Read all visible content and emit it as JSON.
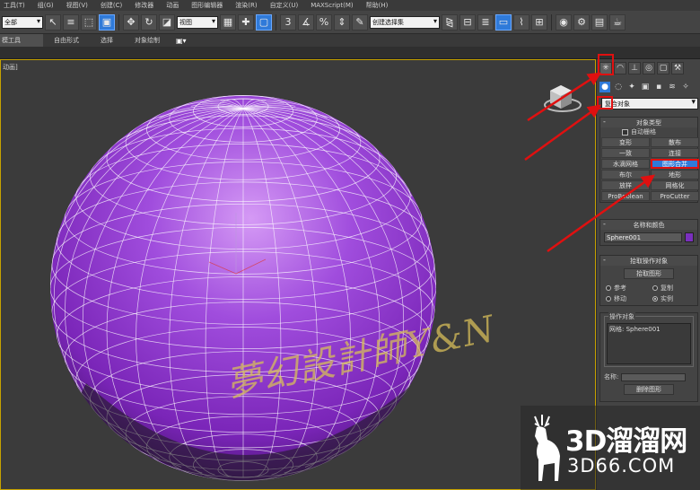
{
  "menubar": {
    "items": [
      "工具(T)",
      "组(G)",
      "视图(V)",
      "创建(C)",
      "修改器",
      "动画",
      "图形编辑器",
      "渲染(R)",
      "自定义(U)",
      "MAXScript(M)",
      "帮助(H)"
    ]
  },
  "toolbar": {
    "selection_filter": "全部",
    "reference_coord": "视图",
    "named_selection": "创建选择集",
    "icons": [
      "undo-icon",
      "redo-icon",
      "link-icon",
      "unlink-icon",
      "bind-icon",
      "select-icon",
      "select-by-name-icon",
      "rect-select-icon",
      "window-crossing-icon",
      "move-icon",
      "rotate-icon",
      "scale-icon",
      "pivot-icon",
      "select-manipulate-icon",
      "snap-icon",
      "angle-snap-icon",
      "percent-snap-icon",
      "spinner-snap-icon",
      "edit-named-sel-icon",
      "mirror-icon",
      "align-icon",
      "layer-icon",
      "ribbon-icon",
      "curve-editor-icon",
      "schematic-icon",
      "material-editor-icon",
      "render-setup-icon",
      "rendered-frame-icon",
      "render-icon"
    ]
  },
  "ribbon": {
    "tabs": [
      "模工具",
      "自由形式",
      "选择",
      "对象绘制"
    ],
    "dropdown_icon": "▣▾"
  },
  "viewport": {
    "label": "动画]",
    "watermark": "夢幻設計師Y&N",
    "sphere_color": "#8a3fd1",
    "wire_color": "#ffffff"
  },
  "command_panel": {
    "tab_icons": [
      "create-icon",
      "modify-icon",
      "hierarchy-icon",
      "motion-icon",
      "display-icon",
      "utilities-icon"
    ],
    "sub_icons": [
      "geometry-icon",
      "shapes-icon",
      "lights-icon",
      "cameras-icon",
      "helpers-icon",
      "spacewarps-icon",
      "systems-icon"
    ],
    "category": "复合对象",
    "object_type": {
      "title": "对象类型",
      "autogrid": "自动栅格",
      "buttons": [
        "变形",
        "散布",
        "一致",
        "连接",
        "水滴网格",
        "图形合并",
        "布尔",
        "地形",
        "放样",
        "网格化",
        "ProBoolean",
        "ProCutter"
      ],
      "selected": "图形合并"
    },
    "name_color": {
      "title": "名称和颜色",
      "name": "Sphere001",
      "color": "#7a2fbe"
    },
    "pick_operand": {
      "title": "拾取操作对象",
      "button": "拾取图形",
      "radios": [
        {
          "label": "参考",
          "on": false
        },
        {
          "label": "复制",
          "on": false
        },
        {
          "label": "移动",
          "on": false
        },
        {
          "label": "实例",
          "on": true
        }
      ]
    },
    "operands": {
      "title": "操作对象",
      "list_item": "网格: Sphere001",
      "name_label": "名称:",
      "delete_button": "删除图形"
    }
  },
  "logo": {
    "line1": "3D溜溜网",
    "line2": "3D66.COM"
  },
  "annotation_color": "#e01010"
}
